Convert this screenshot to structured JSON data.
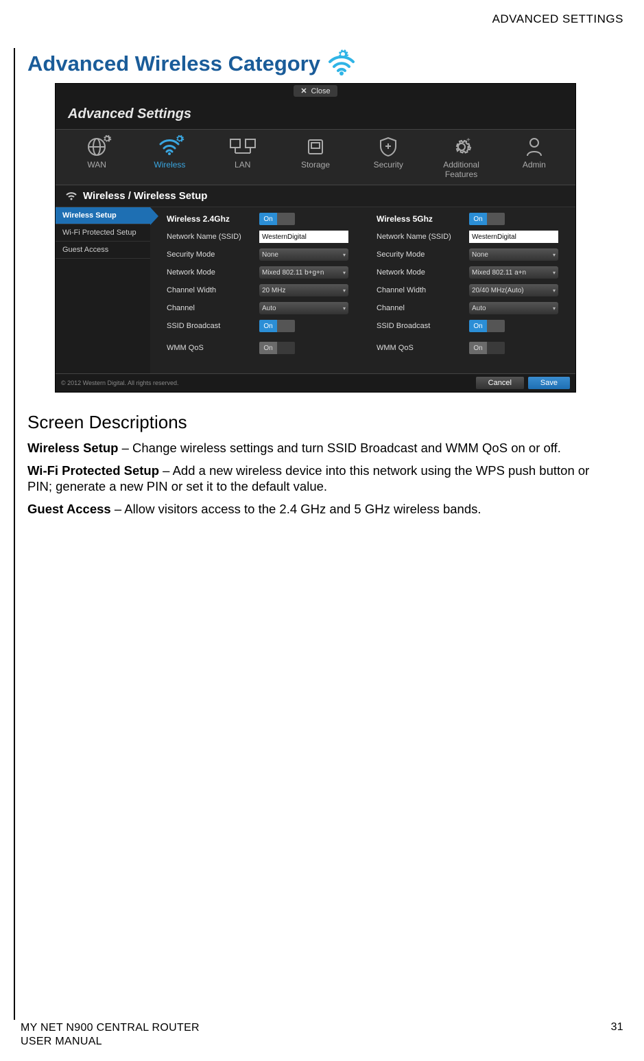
{
  "header_right": "ADVANCED SETTINGS",
  "section_title": "Advanced Wireless Category",
  "figure": {
    "close_label": "Close",
    "window_title": "Advanced Settings",
    "nav": [
      {
        "label": "WAN"
      },
      {
        "label": "Wireless",
        "active": true
      },
      {
        "label": "LAN"
      },
      {
        "label": "Storage"
      },
      {
        "label": "Security"
      },
      {
        "label": "Additional Features"
      },
      {
        "label": "Admin"
      }
    ],
    "breadcrumb": "Wireless / Wireless Setup",
    "sidebar": [
      {
        "label": "Wireless Setup",
        "active": true
      },
      {
        "label": "Wi-Fi Protected Setup"
      },
      {
        "label": "Guest Access"
      }
    ],
    "panels": {
      "left": {
        "title": "Wireless 2.4Ghz",
        "enabled_toggle": "On",
        "rows": [
          {
            "label": "Network Name (SSID)",
            "type": "input",
            "value": "WesternDigital"
          },
          {
            "label": "Security Mode",
            "type": "select",
            "value": "None"
          },
          {
            "label": "Network Mode",
            "type": "select",
            "value": "Mixed 802.11 b+g+n"
          },
          {
            "label": "Channel Width",
            "type": "select",
            "value": "20 MHz"
          },
          {
            "label": "Channel",
            "type": "select",
            "value": "Auto"
          },
          {
            "label": "SSID Broadcast",
            "type": "toggle",
            "value": "On",
            "state": "on"
          },
          {
            "label": "WMM QoS",
            "type": "toggle",
            "value": "On",
            "state": "disabled"
          }
        ]
      },
      "right": {
        "title": "Wireless 5Ghz",
        "enabled_toggle": "On",
        "rows": [
          {
            "label": "Network Name (SSID)",
            "type": "input",
            "value": "WesternDigital"
          },
          {
            "label": "Security Mode",
            "type": "select",
            "value": "None"
          },
          {
            "label": "Network Mode",
            "type": "select",
            "value": "Mixed 802.11 a+n"
          },
          {
            "label": "Channel Width",
            "type": "select",
            "value": "20/40 MHz(Auto)"
          },
          {
            "label": "Channel",
            "type": "select",
            "value": "Auto"
          },
          {
            "label": "SSID Broadcast",
            "type": "toggle",
            "value": "On",
            "state": "on"
          },
          {
            "label": "WMM QoS",
            "type": "toggle",
            "value": "On",
            "state": "disabled"
          }
        ]
      }
    },
    "footer_copyright": "© 2012 Western Digital. All rights reserved.",
    "buttons": {
      "cancel": "Cancel",
      "save": "Save"
    }
  },
  "descriptions": {
    "heading": "Screen Descriptions",
    "items": [
      {
        "term": "Wireless Setup",
        "text": " – Change wireless settings and turn SSID Broadcast and WMM QoS on or off."
      },
      {
        "term": "Wi-Fi Protected Setup",
        "text": " – Add a new wireless device into this network using the WPS push button or PIN; generate a new PIN or set it to the default value."
      },
      {
        "term": "Guest Access",
        "text": " – Allow visitors access to the 2.4 GHz and 5 GHz wireless bands."
      }
    ]
  },
  "footer": {
    "product": "MY NET N900 CENTRAL ROUTER",
    "doc": "USER MANUAL",
    "page": "31"
  }
}
